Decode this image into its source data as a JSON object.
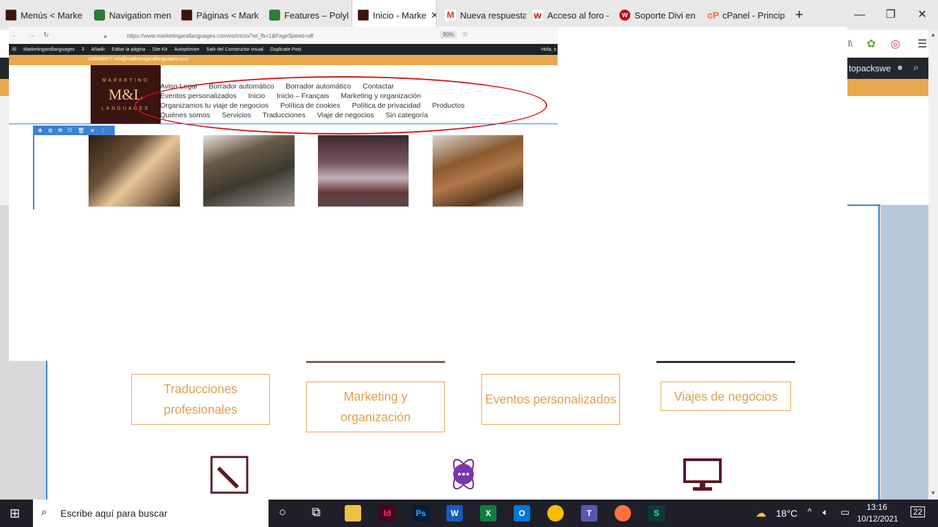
{
  "browser": {
    "tabs": [
      {
        "label": "Menús < Marke",
        "favicon": "ml-icon"
      },
      {
        "label": "Navigation men",
        "favicon": "wp-icon"
      },
      {
        "label": "Páginas < Mark",
        "favicon": "ml-icon"
      },
      {
        "label": "Features – Polyl",
        "favicon": "wp-icon"
      },
      {
        "label": "Inicio - Marke",
        "favicon": "ml-icon"
      },
      {
        "label": "Nueva respuesta",
        "favicon": "gmail-icon"
      },
      {
        "label": "Acceso al foro -",
        "favicon": "w-icon"
      },
      {
        "label": "Soporte Divi en",
        "favicon": "w-icon"
      },
      {
        "label": "cPanel - Princip",
        "favicon": "cpanel-icon"
      }
    ],
    "new_tab": "+",
    "minimize": "—",
    "restore": "❐",
    "close": "✕",
    "right_fragment": "topackswe"
  },
  "embedded": {
    "url": "https://www.marketingandlanguages.com/es/inicio/?et_fb=1&PageSpeed=off",
    "zoom": "90%",
    "admin_bar": [
      "Marketingandlanguages",
      "3",
      "Añadir",
      "Editar la página",
      "Site Kit",
      "Autoptimise",
      "Salir del Constructor visual",
      "Duplicate Post",
      "Hola, s"
    ],
    "contact": "635068977   info@marketingandlanguages.com",
    "logo": {
      "arc_top": "MARKETING",
      "mono": "M&L",
      "arc_bottom": "LANGUAGES"
    },
    "menu": [
      "Aviso Legal",
      "Borrador automático",
      "Borrador automático",
      "Contactar",
      "Eventos personalizados",
      "Inicio",
      "Inicio – Français",
      "Marketing y organización",
      "Organizamos tu viaje de negocios",
      "Política de cookies",
      "Política de privacidad",
      "Productos",
      "Quiénes somos",
      "Servicios",
      "Traducciones",
      "Viaje de negocios",
      "Sin categoría"
    ]
  },
  "page": {
    "buttons": [
      "Traducciones profesionales",
      "Marketing y organización",
      "Eventos personalizados",
      "Viajes de negocios"
    ]
  },
  "taskbar": {
    "search_placeholder": "Escribe aquí para buscar",
    "weather": "18°C",
    "time": "13:16",
    "date": "10/12/2021",
    "notifications": "22"
  }
}
